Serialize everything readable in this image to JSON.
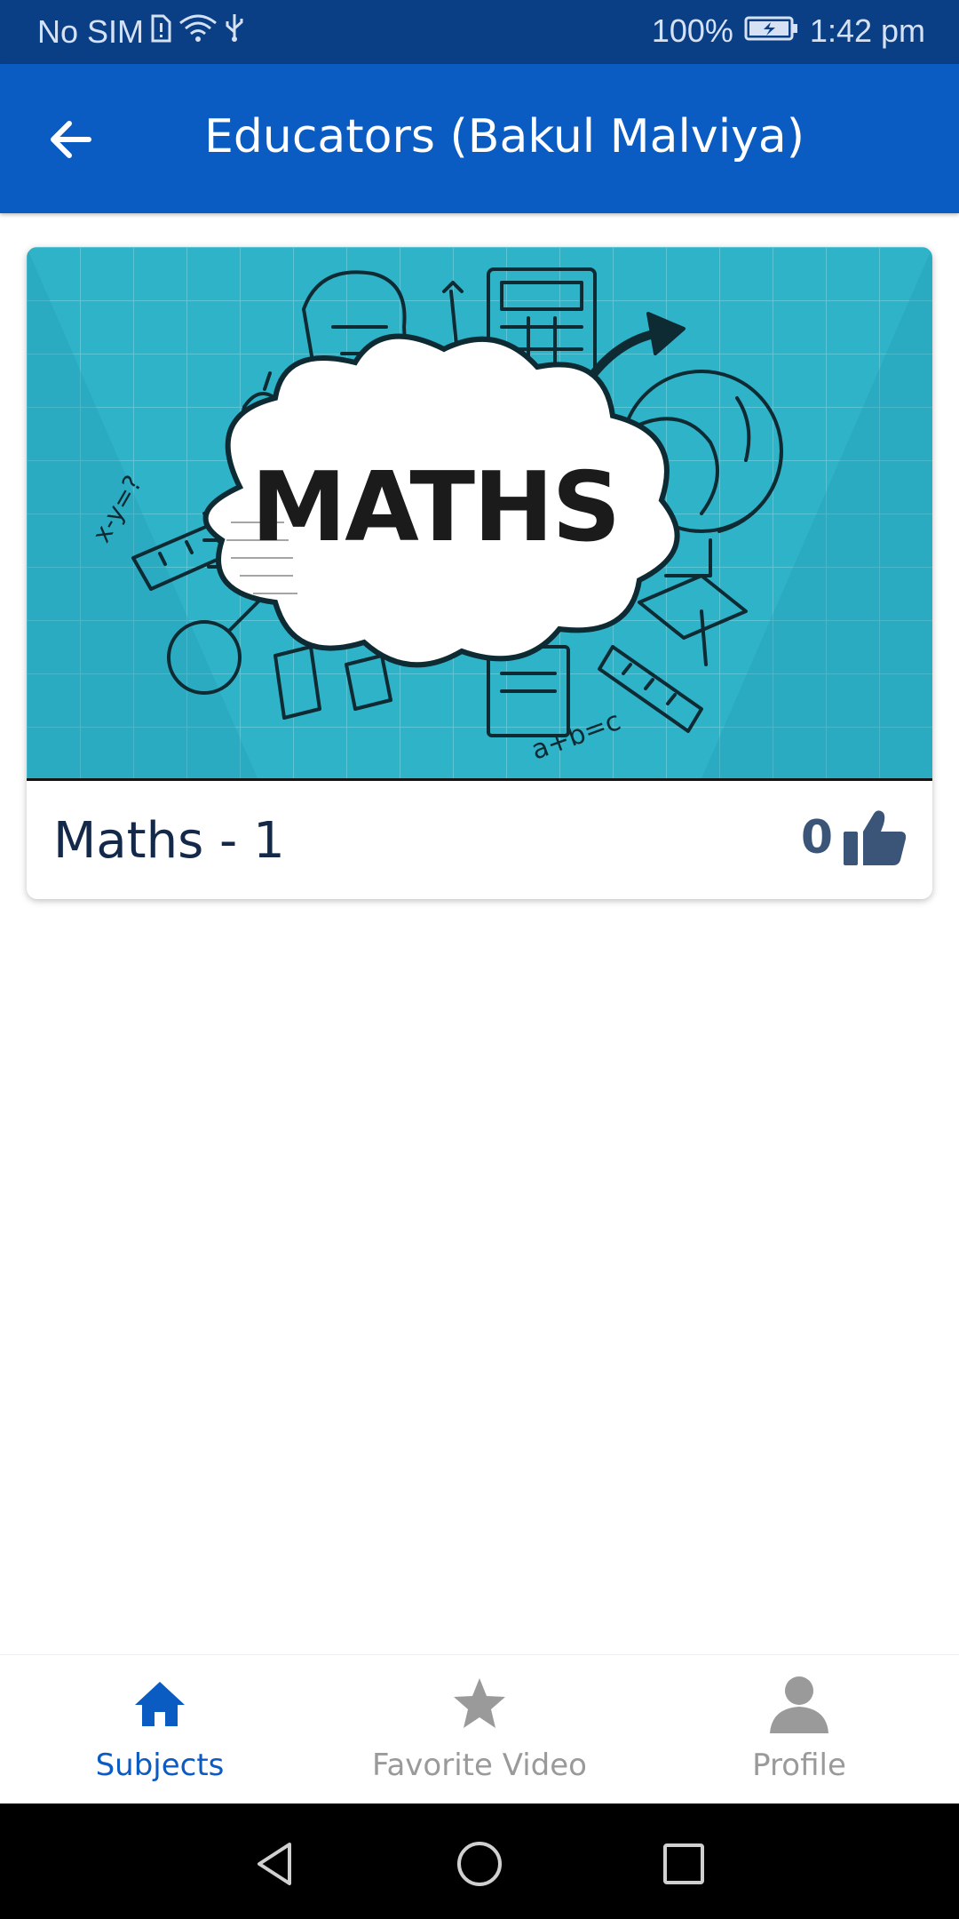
{
  "status_bar": {
    "carrier": "No SIM",
    "battery": "100%",
    "time": "1:42 pm"
  },
  "header": {
    "title": "Educators (Bakul Malviya)",
    "back_icon": "arrow-back-icon"
  },
  "videos": [
    {
      "title": "Maths - 1",
      "likes": "0",
      "thumbnail_text": "MATHS",
      "thumbnail_formula_left": "x-y=?",
      "thumbnail_formula_bottom": "a+b=c"
    }
  ],
  "bottom_nav": {
    "items": [
      {
        "label": "Subjects",
        "icon": "home-icon",
        "active": true
      },
      {
        "label": "Favorite Video",
        "icon": "star-icon",
        "active": false
      },
      {
        "label": "Profile",
        "icon": "person-icon",
        "active": false
      }
    ]
  },
  "colors": {
    "status_bar": "#0a3f86",
    "app_bar": "#0a5bc2",
    "active_tab": "#0a5bc2",
    "inactive_tab": "#9a9a9a",
    "thumbnail_bg": "#2fb3c9"
  }
}
